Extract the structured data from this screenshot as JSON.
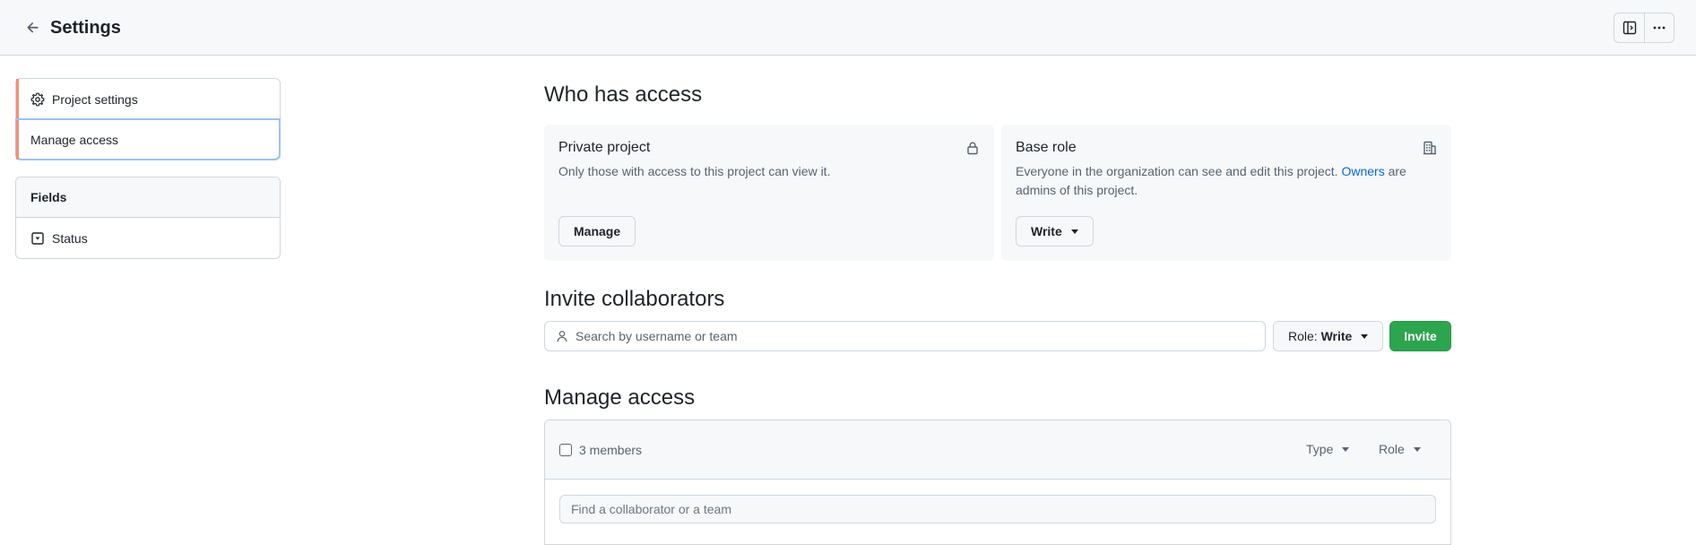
{
  "header": {
    "title": "Settings"
  },
  "sidebar": {
    "items": [
      {
        "label": "Project settings",
        "icon": "gear-icon"
      },
      {
        "label": "Manage access"
      }
    ],
    "fields": {
      "heading": "Fields",
      "items": [
        {
          "label": "Status",
          "icon": "single-select-icon"
        }
      ]
    }
  },
  "who_has_access": {
    "heading": "Who has access",
    "private_card": {
      "title": "Private project",
      "text": "Only those with access to this project can view it.",
      "button": "Manage",
      "icon": "lock-icon"
    },
    "base_role_card": {
      "title": "Base role",
      "text_before": "Everyone in the organization can see and edit this project. ",
      "link": "Owners",
      "text_after": " are admins of this project.",
      "button": "Write",
      "icon": "organization-icon"
    }
  },
  "invite": {
    "heading": "Invite collaborators",
    "search_placeholder": "Search by username or team",
    "role_prefix": "Role:",
    "role_value": "Write",
    "invite_button": "Invite"
  },
  "manage_access": {
    "heading": "Manage access",
    "members_count": "3 members",
    "type_filter": "Type",
    "role_filter": "Role",
    "find_placeholder": "Find a collaborator or a team"
  },
  "colors": {
    "accent_nav": "#fd8c73",
    "invite_green": "#2da44e",
    "link_blue": "#0969da"
  }
}
